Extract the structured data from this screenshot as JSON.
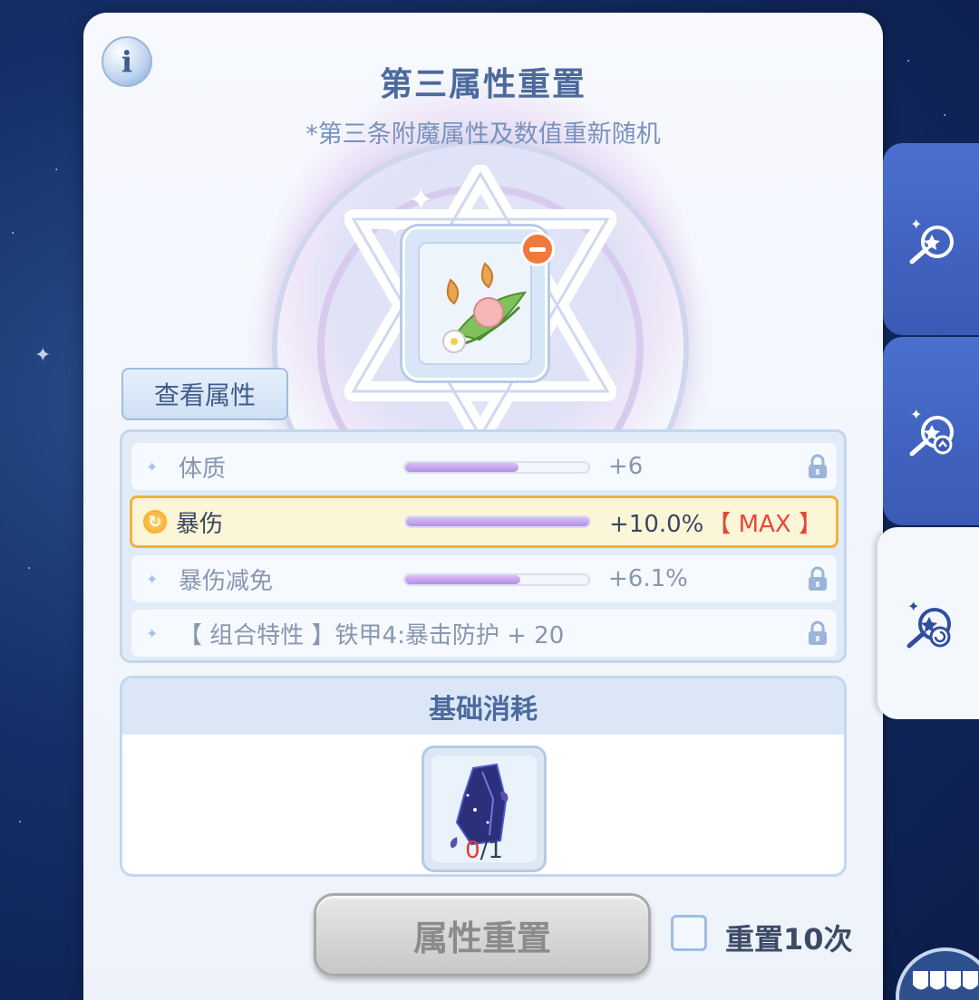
{
  "panel": {
    "title": "第三属性重置",
    "subtitle": "*第三条附魔属性及数值重新随机"
  },
  "info_button": {
    "label": "i"
  },
  "view_attributes_button": {
    "label": "查看属性"
  },
  "attributes": [
    {
      "name": "体质",
      "value": "+6",
      "fill": 0.62,
      "highlighted": false,
      "locked": true,
      "max_label": ""
    },
    {
      "name": "暴伤",
      "value": "+10.0%",
      "fill": 1.0,
      "highlighted": true,
      "locked": false,
      "max_label": "【 MAX 】"
    },
    {
      "name": "暴伤减免",
      "value": "+6.1%",
      "fill": 0.63,
      "highlighted": false,
      "locked": true,
      "max_label": ""
    }
  ],
  "combo_trait": {
    "text": "【 组合特性 】铁甲4:暴击防护 + 20",
    "locked": true
  },
  "cost": {
    "header": "基础消耗",
    "owned": "0",
    "required": "/1"
  },
  "reset_button": {
    "label": "属性重置"
  },
  "reset_ten": {
    "label": "重置10次",
    "checked": false
  },
  "colors": {
    "accent_blue": "#4b6a9e",
    "highlight_border": "#f3b13b",
    "max_red": "#e4483a",
    "bar_fill": "#b58ee6",
    "tab_blue": "#3a5ab4"
  },
  "side_tabs": [
    {
      "icon": "enchant-star-icon",
      "active": false
    },
    {
      "icon": "enchant-upgrade-icon",
      "active": false
    },
    {
      "icon": "enchant-reset-icon",
      "active": true
    }
  ],
  "shop_icon": "shop-awning-icon"
}
